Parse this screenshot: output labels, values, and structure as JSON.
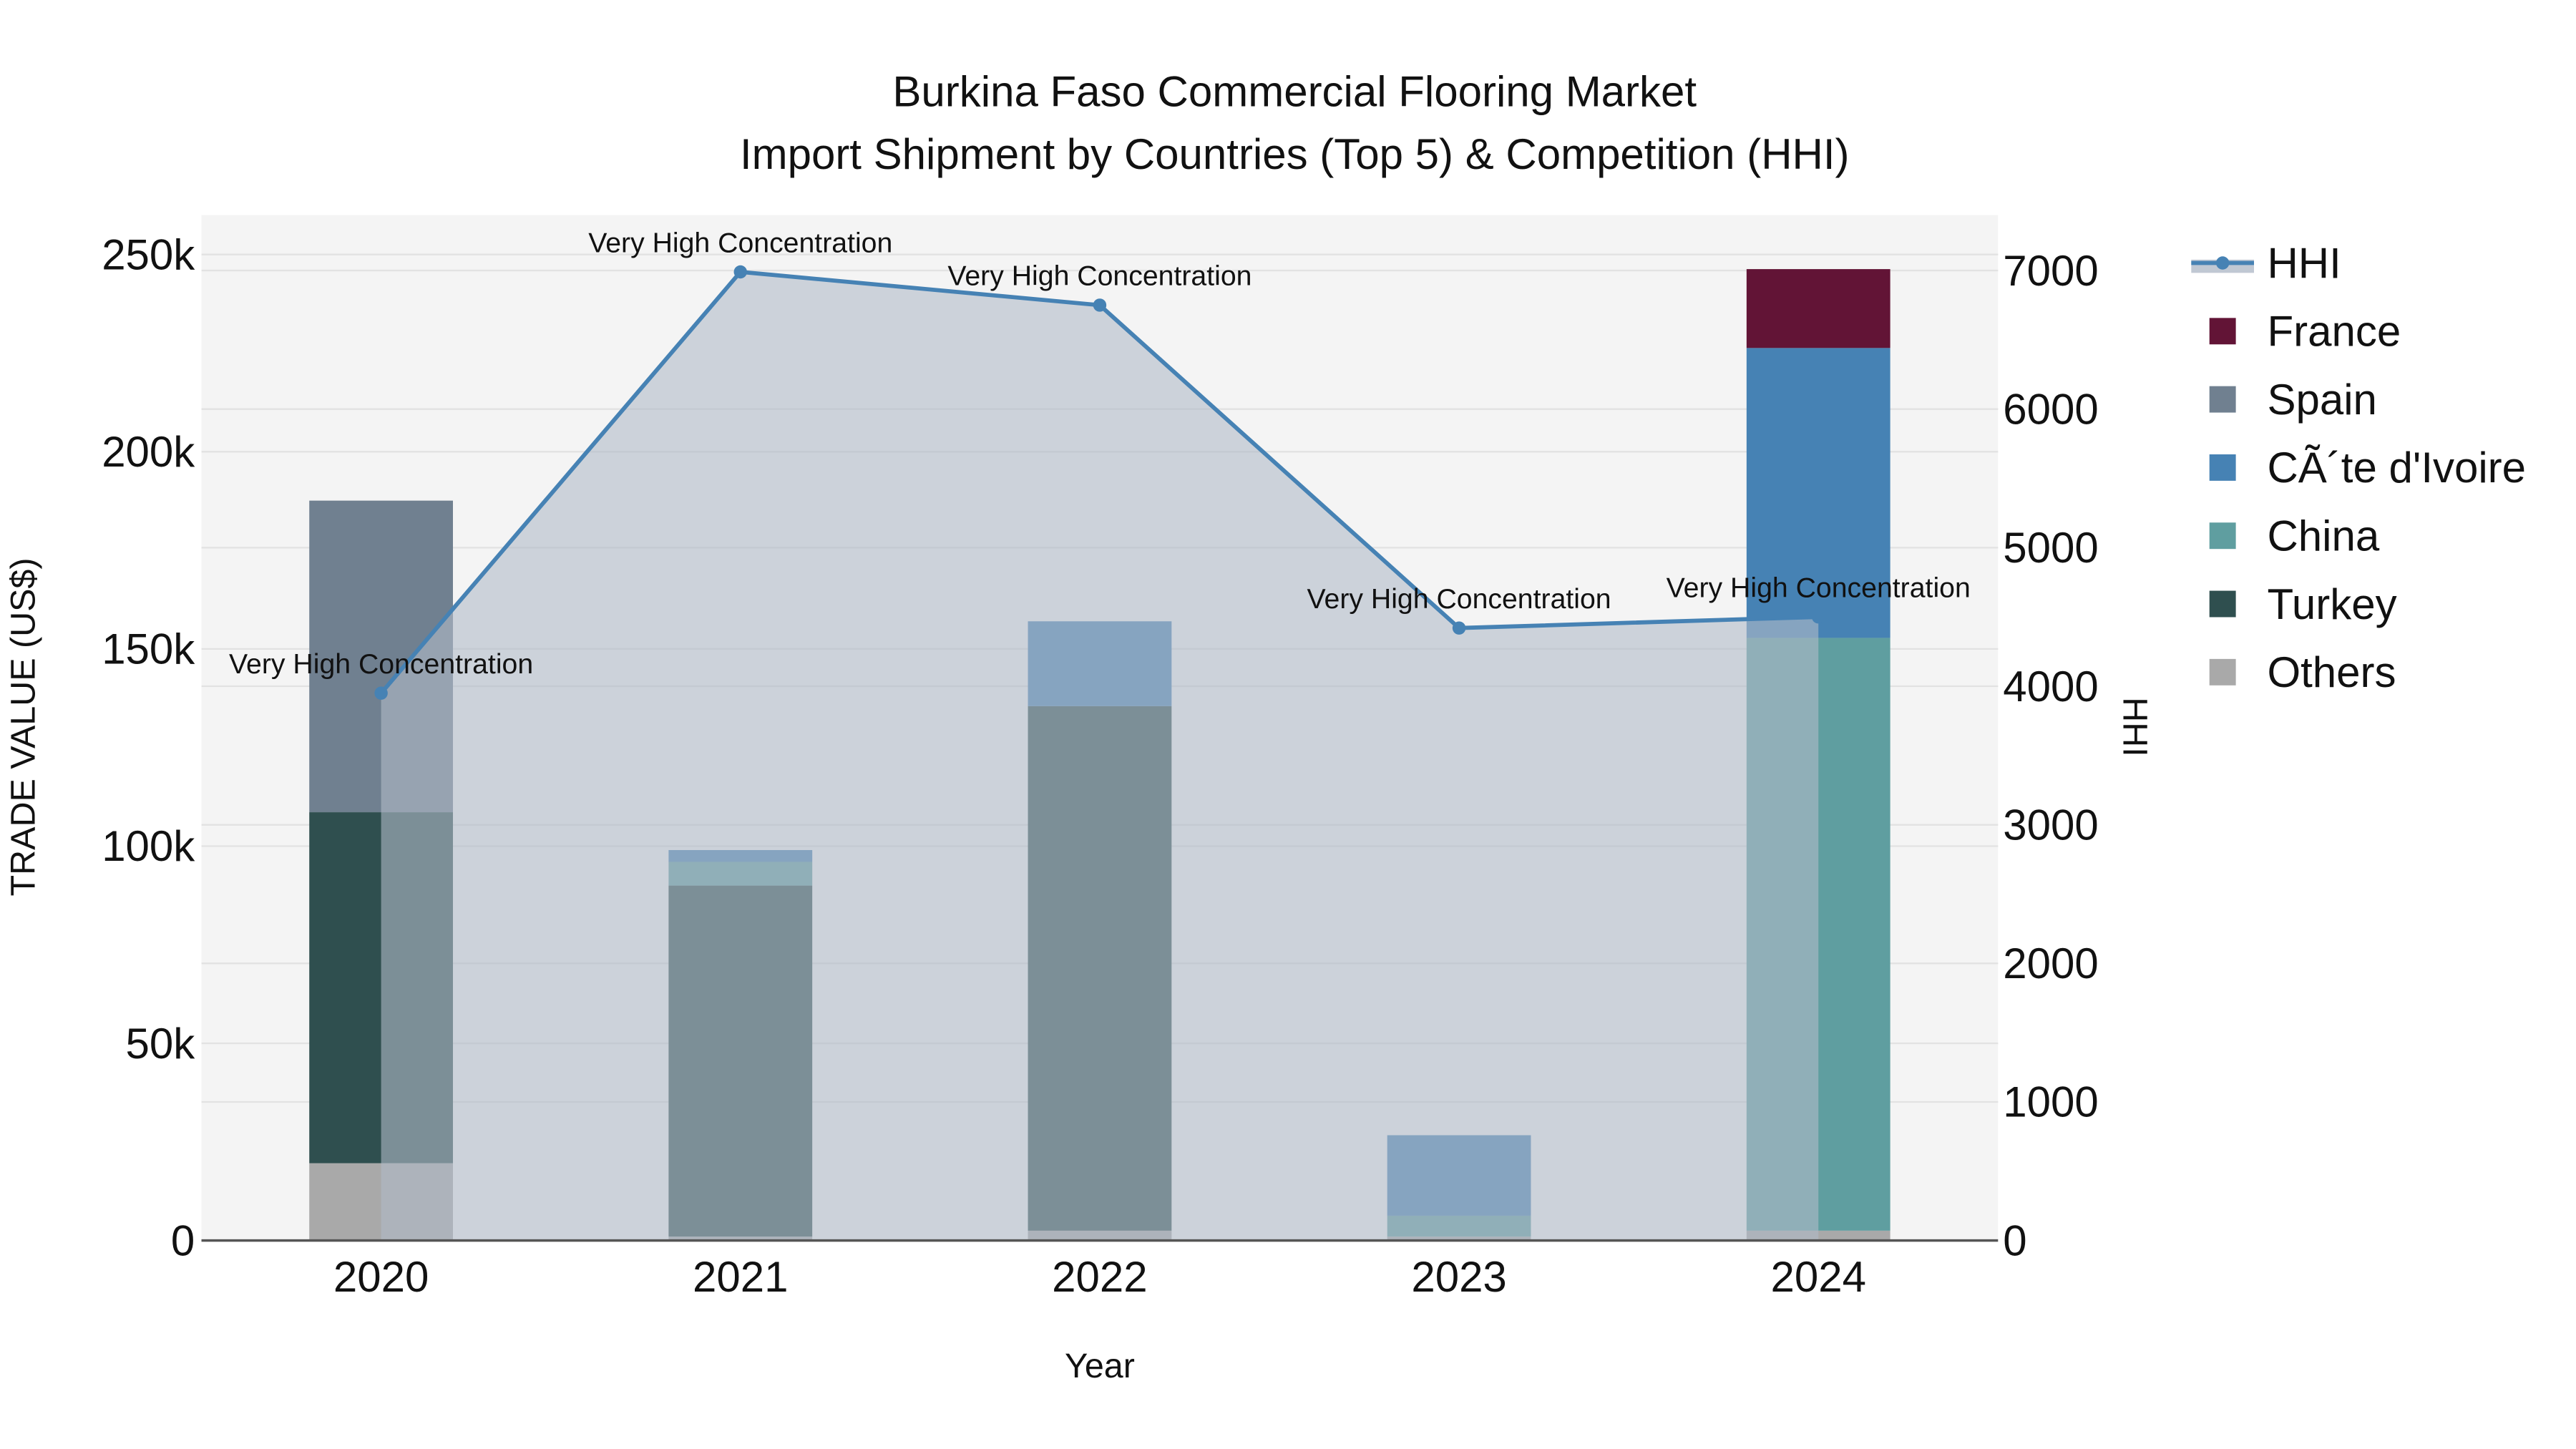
{
  "chart_data": {
    "type": "bar",
    "title_line1": "Burkina Faso Commercial Flooring Market",
    "title_line2": "Import Shipment by Countries (Top 5) & Competition (HHI)",
    "xlabel": "Year",
    "ylabel": "TRADE VALUE (US$)",
    "y2label": "HHI",
    "categories": [
      "2020",
      "2021",
      "2022",
      "2023",
      "2024"
    ],
    "ylim": [
      0,
      260000
    ],
    "y2lim": [
      0,
      7400
    ],
    "yticks": [
      0,
      50000,
      100000,
      150000,
      200000,
      250000
    ],
    "ytick_labels": [
      "0",
      "50k",
      "100k",
      "150k",
      "200k",
      "250k"
    ],
    "y2ticks": [
      0,
      1000,
      2000,
      3000,
      4000,
      5000,
      6000,
      7000
    ],
    "y2tick_labels": [
      "0",
      "1000",
      "2000",
      "3000",
      "4000",
      "5000",
      "6000",
      "7000"
    ],
    "grid": true,
    "legend_position": "right",
    "stack_order": [
      "Others",
      "Turkey",
      "China",
      "CÃ´te d'Ivoire",
      "Spain",
      "France"
    ],
    "series": [
      {
        "name": "France",
        "color": "#621436",
        "values": [
          0,
          0,
          0,
          0,
          20000
        ]
      },
      {
        "name": "Spain",
        "color": "#708090",
        "values": [
          79000,
          0,
          0,
          0,
          0
        ]
      },
      {
        "name": "CÃ´te d'Ivoire",
        "color": "#4682b4",
        "values": [
          0,
          3000,
          21500,
          20400,
          73500
        ]
      },
      {
        "name": "China",
        "color": "#5f9ea0",
        "values": [
          0,
          6000,
          0,
          5300,
          150300
        ]
      },
      {
        "name": "Turkey",
        "color": "#2f4f4f",
        "values": [
          89000,
          89000,
          133000,
          0,
          0
        ]
      },
      {
        "name": "Others",
        "color": "#a9a9a9",
        "values": [
          19600,
          1000,
          2500,
          1000,
          2500
        ]
      }
    ],
    "hhi": {
      "name": "HHI",
      "color": "#4682b4",
      "values": [
        3950,
        6990,
        6750,
        4420,
        4500
      ],
      "annotations": [
        "Very High Concentration",
        "Very High Concentration",
        "Very High Concentration",
        "Very High Concentration",
        "Very High Concentration"
      ]
    },
    "legend": [
      "HHI",
      "France",
      "Spain",
      "CÃ´te d'Ivoire",
      "China",
      "Turkey",
      "Others"
    ]
  }
}
